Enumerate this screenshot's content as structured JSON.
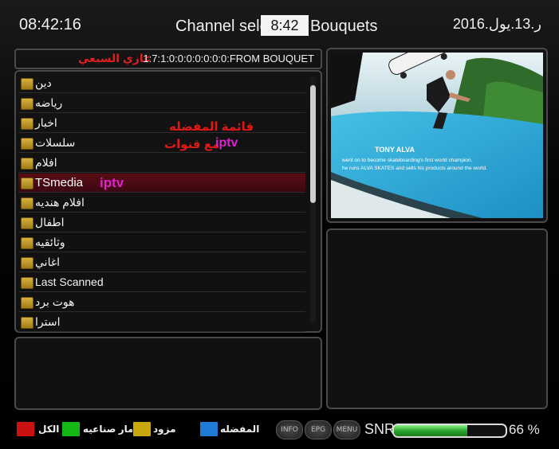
{
  "header": {
    "clock": "08:42:16",
    "title": "Channel selec     (   ) - Bouquets",
    "title_overlay": "8:42",
    "date": "2016.ر.13.يول"
  },
  "path_bar": {
    "path": "1:7:1:0:0:0:0:0:0:0:FROM BOUQUET",
    "owner_name": "غازي السبعي"
  },
  "bouquets": {
    "items": [
      {
        "label": "دين"
      },
      {
        "label": "رياضه"
      },
      {
        "label": "اخبار"
      },
      {
        "label": "سلسلات"
      },
      {
        "label": "افلام"
      },
      {
        "label": "TSmedia"
      },
      {
        "label": "افلام هنديه"
      },
      {
        "label": "اطفال"
      },
      {
        "label": "وثائقيه"
      },
      {
        "label": "اغاني"
      },
      {
        "label": "Last Scanned"
      },
      {
        "label": "هوت برد"
      },
      {
        "label": "استرا"
      }
    ],
    "selected_index": 5,
    "scroll_fraction": 0.45
  },
  "annotations": {
    "favorites_list": "قائمة المفضله",
    "with_channels_prefix": "مع قنوات",
    "iptv_secondary": "iptv",
    "iptv_selected": "iptv"
  },
  "preview": {
    "caption_title": "TONY ALVA",
    "caption_line1": "went on to become skateboarding's first world champion.",
    "caption_line2": "he runs ALVA SKATES and sells his products around the world."
  },
  "keys": {
    "red_label": "الكل",
    "green_label": "اقمار صناعيه",
    "yellow_label": "مزود",
    "blue_label": "المفضله",
    "info_label": "INFO",
    "epg_label": "EPG",
    "menu_label": "MENU",
    "colors": {
      "red": "#cc1111",
      "green": "#14b814",
      "yellow": "#c9a80e",
      "blue": "#1e7bd6"
    }
  },
  "signal": {
    "snr_label": "SNR",
    "snr_value": "66 %",
    "snr_level": 0.66
  },
  "icons": {
    "folder": "folder-icon"
  }
}
